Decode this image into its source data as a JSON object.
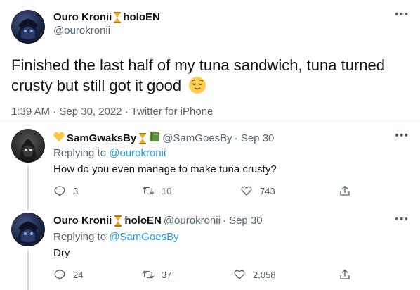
{
  "main_tweet": {
    "display_name": "Ouro Kronii",
    "name_suffix": "holoEN",
    "handle": "@ourokronii",
    "text": "Finished the last half of my tuna sandwich, tuna turned crusty but still got it good",
    "meta": "1:39 AM · Sep 30, 2022 · Twitter for iPhone"
  },
  "replies": [
    {
      "display_name": "SamGwaksBy",
      "handle": "@SamGoesBy",
      "date": "· Sep 30",
      "replying_prefix": "Replying to ",
      "replying_to": "@ourokronii",
      "text": "How do you even manage to make tuna crusty?",
      "reply_count": "3",
      "retweet_count": "10",
      "like_count": "743"
    },
    {
      "display_name": "Ouro Kronii",
      "name_suffix": "holoEN",
      "handle": "@ourokronii",
      "date": "· Sep 30",
      "replying_prefix": "Replying to ",
      "replying_to": "@SamGoesBy",
      "text": "Dry",
      "reply_count": "24",
      "retweet_count": "37",
      "like_count": "2,058"
    }
  ],
  "icons": {
    "more": "more-dots-icon",
    "reply": "reply-icon",
    "retweet": "retweet-icon",
    "like": "heart-icon",
    "share": "share-icon",
    "emoji": "relieved-face-emoji"
  },
  "colors": {
    "link": "#1d9bf0",
    "secondary_text": "#536471",
    "hourglass": "#f4a81d"
  }
}
